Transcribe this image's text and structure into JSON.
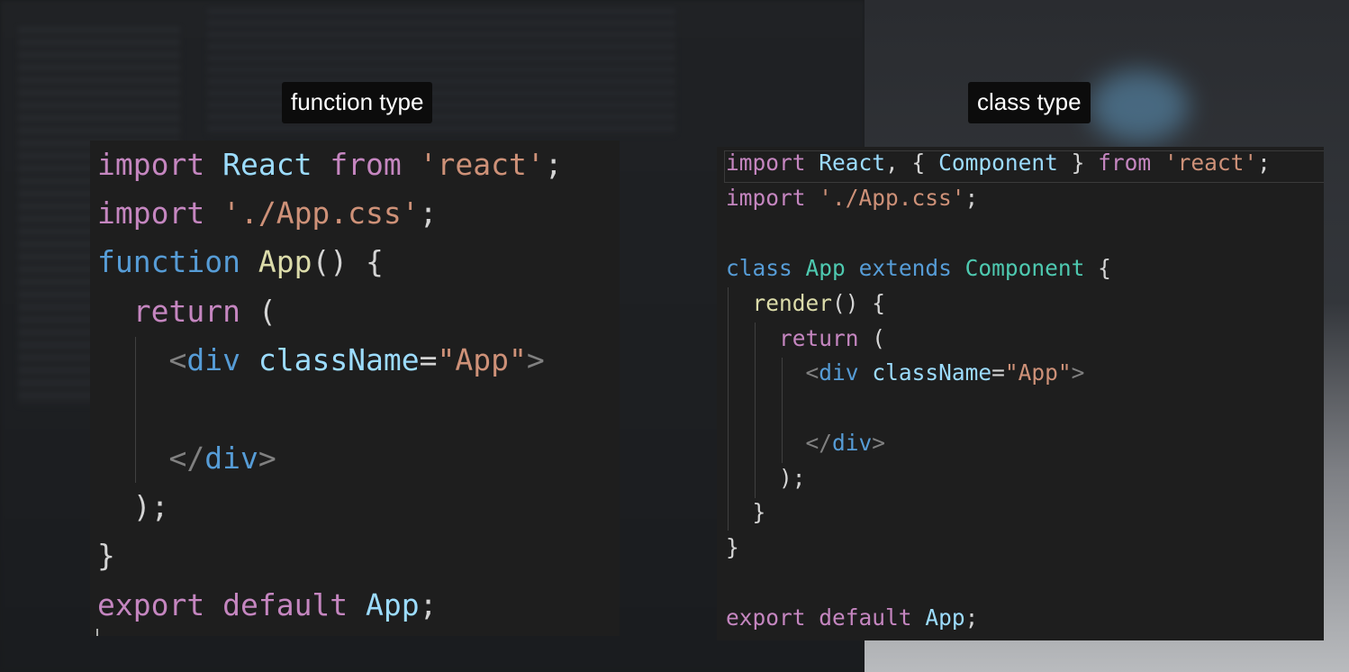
{
  "captions": {
    "function": "function type",
    "class": "class type"
  },
  "function_code": {
    "l1": {
      "kw": "import",
      "id": "React",
      "from": "from",
      "str": "'react'",
      "end": ";"
    },
    "l2": {
      "kw": "import",
      "str": "'./App.css'",
      "end": ";"
    },
    "l3": {
      "kw": "function",
      "fn": "App",
      "rest": "() {"
    },
    "l4": {
      "kw": "return",
      "rest": "("
    },
    "l5": {
      "lt": "<",
      "tag": "div",
      "attr": "className",
      "eq": "=",
      "str": "\"App\"",
      "gt": ">"
    },
    "l7": {
      "lt": "</",
      "tag": "div",
      "gt": ">"
    },
    "l8": {
      "rest": ");"
    },
    "l9": {
      "rest": "}"
    },
    "l10": {
      "kw1": "export",
      "kw2": "default",
      "id": "App",
      "end": ";"
    }
  },
  "class_code": {
    "l1": {
      "kw": "import",
      "id": "React",
      "mid": ", { ",
      "comp": "Component",
      "close": " } ",
      "from": "from",
      "str": "'react'",
      "end": ";"
    },
    "l2": {
      "kw": "import",
      "str": "'./App.css'",
      "end": ";"
    },
    "l4": {
      "kw": "class",
      "cls": "App",
      "ext": "extends",
      "comp": "Component",
      "rest": " {"
    },
    "l5": {
      "fn": "render",
      "rest": "() {"
    },
    "l6": {
      "kw": "return",
      "rest": " ("
    },
    "l7": {
      "lt": "<",
      "tag": "div",
      "attr": "className",
      "eq": "=",
      "str": "\"App\"",
      "gt": ">"
    },
    "l9": {
      "lt": "</",
      "tag": "div",
      "gt": ">"
    },
    "l10": {
      "rest": ");"
    },
    "l11": {
      "rest": "}"
    },
    "l12": {
      "rest": "}"
    },
    "l14": {
      "kw1": "export",
      "kw2": "default",
      "id": "App",
      "end": ";"
    }
  }
}
